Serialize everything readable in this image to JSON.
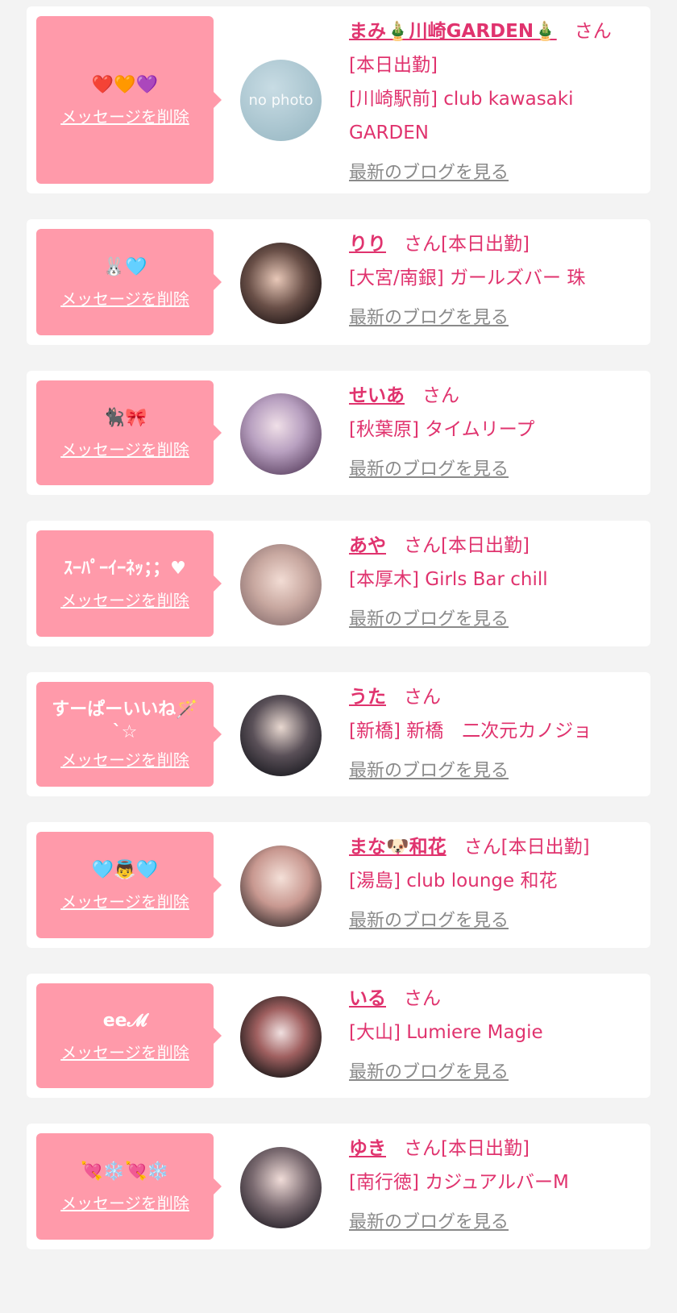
{
  "delete_label": "メッセージを削除",
  "blog_label": "最新のブログを見る",
  "honorific": "さん",
  "colors": {
    "accent": "#e0336e",
    "bubble": "#ff9aaa",
    "link_gray": "#8a8a8a",
    "bg": "#f3f3f3"
  },
  "cards": [
    {
      "message": "❤️🧡💜",
      "name": "まみ🎍川崎GARDEN🎍",
      "status": "[本日出勤]",
      "shop": "[川崎駅前] club kawasaki GARDEN",
      "avatar_text": "no photo"
    },
    {
      "message": "🐰🩵",
      "name": "りり",
      "status": "[本日出勤]",
      "shop": "[大宮/南銀] ガールズバー 珠",
      "avatar_text": ""
    },
    {
      "message": "🐈‍⬛🎀",
      "name": "せいあ",
      "status": "",
      "shop": "[秋葉原] タイムリープ",
      "avatar_text": ""
    },
    {
      "message": "ｽｰﾊﾟｰｲｰﾈｯ；；♥",
      "name": "あや",
      "status": "[本日出勤]",
      "shop": "[本厚木] Girls Bar chill",
      "avatar_text": ""
    },
    {
      "message": "すーぱーいいね🪄\n`☆",
      "name": "うた",
      "status": "",
      "shop": "[新橋] 新橋　二次元カノジョ",
      "avatar_text": ""
    },
    {
      "message": "🩵👼🩵",
      "name": "まな🐶和花",
      "status": "[本日出勤]",
      "shop": "[湯島] club lounge 和花",
      "avatar_text": ""
    },
    {
      "message": "ee𝓜",
      "name": "いる",
      "status": "",
      "shop": "[大山] Lumiere Magie",
      "avatar_text": ""
    },
    {
      "message": "💘❄️💘❄️",
      "name": "ゆき",
      "status": "[本日出勤]",
      "shop": "[南行徳] カジュアルバーM",
      "avatar_text": ""
    }
  ]
}
